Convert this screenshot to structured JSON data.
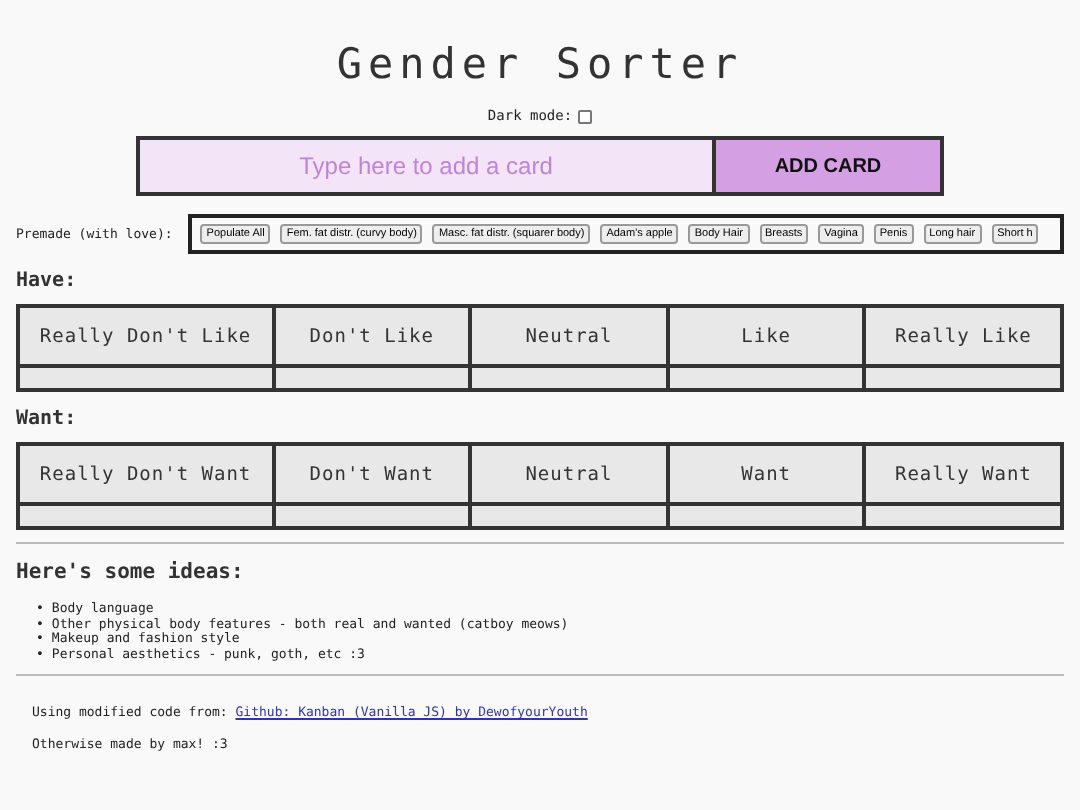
{
  "title": "Gender Sorter",
  "dark_mode": {
    "label": "Dark mode:",
    "checked": false
  },
  "add_card": {
    "placeholder": "Type here to add a card",
    "button": "ADD CARD"
  },
  "premade": {
    "label": "Premade (with love):",
    "buttons": [
      "Populate All",
      "Fem. fat distr. (curvy body)",
      "Masc. fat distr. (squarer body)",
      "Adam's apple",
      "Body Hair",
      "Breasts",
      "Vagina",
      "Penis",
      "Long hair",
      "Short h"
    ]
  },
  "boards": [
    {
      "heading": "Have:",
      "columns": [
        "Really Don't Like",
        "Don't Like",
        "Neutral",
        "Like",
        "Really Like"
      ]
    },
    {
      "heading": "Want:",
      "columns": [
        "Really Don't Want",
        "Don't Want",
        "Neutral",
        "Want",
        "Really Want"
      ]
    }
  ],
  "ideas": {
    "heading": "Here's some ideas:",
    "items": [
      {
        "marker": "•",
        "text": "Body language"
      },
      {
        "marker": "•",
        "text": "Other physical body features - both real and wanted (catboy meows)"
      },
      {
        "marker": "•",
        "text": "Makeup and fashion style"
      },
      {
        "marker": "•",
        "text": "Personal aesthetics - punk, goth, etc :3"
      }
    ]
  },
  "footer": {
    "credit": "Using modified code from:",
    "link": "Github: Kanban (Vanilla JS) by DewofyourYouth",
    "note": "Otherwise made by max! :3"
  }
}
